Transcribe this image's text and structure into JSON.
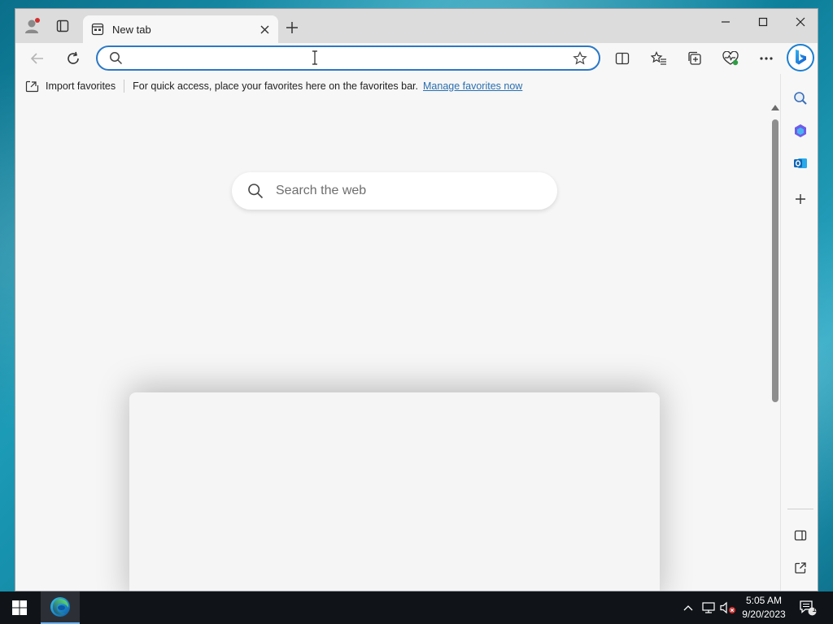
{
  "browser": {
    "tab": {
      "title": "New tab"
    },
    "address": {
      "value": "",
      "placeholder": ""
    },
    "favorites_bar": {
      "import_label": "Import favorites",
      "message": "For quick access, place your favorites here on the favorites bar.",
      "manage_link": "Manage favorites now"
    },
    "new_tab_page": {
      "search_placeholder": "Search the web"
    },
    "icons": {
      "profile": "profile-icon",
      "tab_actions": "tab-actions-icon",
      "back": "back-arrow-icon",
      "refresh": "refresh-icon",
      "favorite": "star-icon",
      "split_screen": "split-screen-icon",
      "favorites": "favorites-icon",
      "collections": "collections-icon",
      "browser_essentials": "heart-pulse-icon",
      "more": "more-icon",
      "bing": "bing-copilot-icon"
    },
    "sidebar": [
      "search-icon",
      "copilot-icon",
      "outlook-icon",
      "add-icon",
      "hide-sidebar-icon",
      "open-external-icon",
      "settings-icon"
    ]
  },
  "taskbar": {
    "time": "5:05 AM",
    "date": "9/20/2023",
    "notification_count": "1"
  },
  "colors": {
    "accent": "#2b78c6",
    "link": "#2a6fb0",
    "taskbar": "#101418"
  }
}
